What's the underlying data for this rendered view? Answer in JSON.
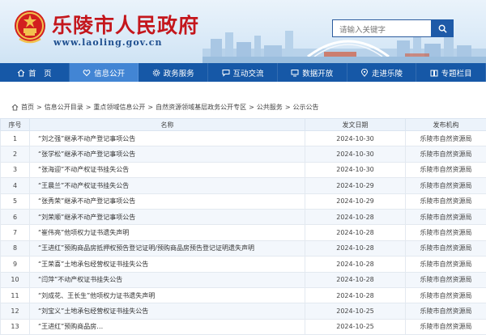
{
  "header": {
    "site_title": "乐陵市人民政府",
    "site_url": "www.laoling.gov.cn",
    "search_placeholder": "请输入关键字"
  },
  "nav": {
    "items": [
      {
        "label": "首　页",
        "icon": "home-icon"
      },
      {
        "label": "信息公开",
        "icon": "heart-icon",
        "active": true
      },
      {
        "label": "政务服务",
        "icon": "gear-icon"
      },
      {
        "label": "互动交流",
        "icon": "chat-icon"
      },
      {
        "label": "数据开放",
        "icon": "monitor-icon"
      },
      {
        "label": "走进乐陵",
        "icon": "location-icon"
      },
      {
        "label": "专题栏目",
        "icon": "book-icon"
      }
    ]
  },
  "breadcrumb": {
    "items": [
      "首页",
      "信息公开目录",
      "重点领域信息公开",
      "自然资源领域基层政务公开专区",
      "公共服务",
      "公示公告"
    ],
    "separator": ">"
  },
  "table": {
    "headers": {
      "index": "序号",
      "name": "名称",
      "date": "发文日期",
      "org": "发布机构"
    },
    "rows": [
      {
        "index": "1",
        "name": "“刘之强”继承不动产登记事项公告",
        "date": "2024-10-30",
        "org": "乐陵市自然资源局"
      },
      {
        "index": "2",
        "name": "“张学松”继承不动产登记事项公告",
        "date": "2024-10-30",
        "org": "乐陵市自然资源局"
      },
      {
        "index": "3",
        "name": "“张海迎”不动产权证书挂失公告",
        "date": "2024-10-30",
        "org": "乐陵市自然资源局"
      },
      {
        "index": "4",
        "name": "“王晨兰”不动产权证书挂失公告",
        "date": "2024-10-29",
        "org": "乐陵市自然资源局"
      },
      {
        "index": "5",
        "name": "“张秀荣”继承不动产登记事项公告",
        "date": "2024-10-29",
        "org": "乐陵市自然资源局"
      },
      {
        "index": "6",
        "name": "“刘荣顺”继承不动产登记事项公告",
        "date": "2024-10-28",
        "org": "乐陵市自然资源局"
      },
      {
        "index": "7",
        "name": "“崔伟亮”他项权力证书遗失声明",
        "date": "2024-10-28",
        "org": "乐陵市自然资源局"
      },
      {
        "index": "8",
        "name": "“王进红”预购商品房抵押权预告登记证明/预购商品房预告登记证明遗失声明",
        "date": "2024-10-28",
        "org": "乐陵市自然资源局"
      },
      {
        "index": "9",
        "name": "“王荣喜”土地承包经营权证书挂失公告",
        "date": "2024-10-28",
        "org": "乐陵市自然资源局"
      },
      {
        "index": "10",
        "name": "“闫萍”不动产权证书挂失公告",
        "date": "2024-10-28",
        "org": "乐陵市自然资源局"
      },
      {
        "index": "11",
        "name": "“刘成花、王长生”他项权力证书遗失声明",
        "date": "2024-10-28",
        "org": "乐陵市自然资源局"
      },
      {
        "index": "12",
        "name": "“刘宝义”土地承包经营权证书挂失公告",
        "date": "2024-10-25",
        "org": "乐陵市自然资源局"
      },
      {
        "index": "13",
        "name": "“王进红”预购商品房…",
        "date": "2024-10-25",
        "org": "乐陵市自然资源局"
      }
    ]
  },
  "colors": {
    "title_red": "#c4161c",
    "nav_blue": "#1658a7",
    "nav_active": "#4285d4",
    "header_bg": "#dcebf8"
  }
}
